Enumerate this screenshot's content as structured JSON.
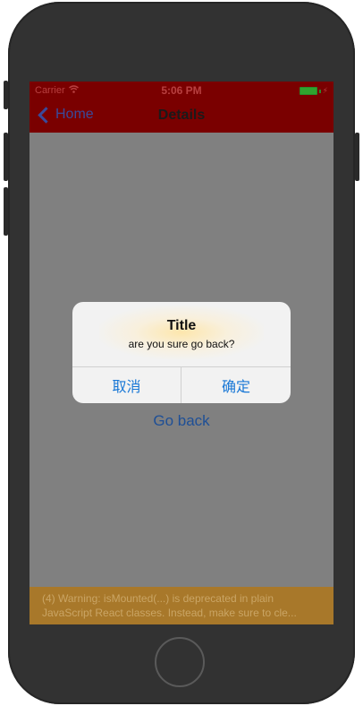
{
  "status_bar": {
    "carrier": "Carrier",
    "time": "5:06 PM",
    "battery_color": "#2fa42f"
  },
  "nav_bar": {
    "back_label": "Home",
    "title": "Details",
    "background": "#7a0000"
  },
  "content": {
    "go_back_link": "Go back"
  },
  "alert": {
    "title": "Title",
    "message": "are you sure go back?",
    "cancel_label": "取消",
    "confirm_label": "确定",
    "button_color": "#1877d6"
  },
  "warning": {
    "line1": "(4) Warning: isMounted(...) is deprecated in plain",
    "line2": "JavaScript React classes. Instead, make sure to cle..."
  }
}
